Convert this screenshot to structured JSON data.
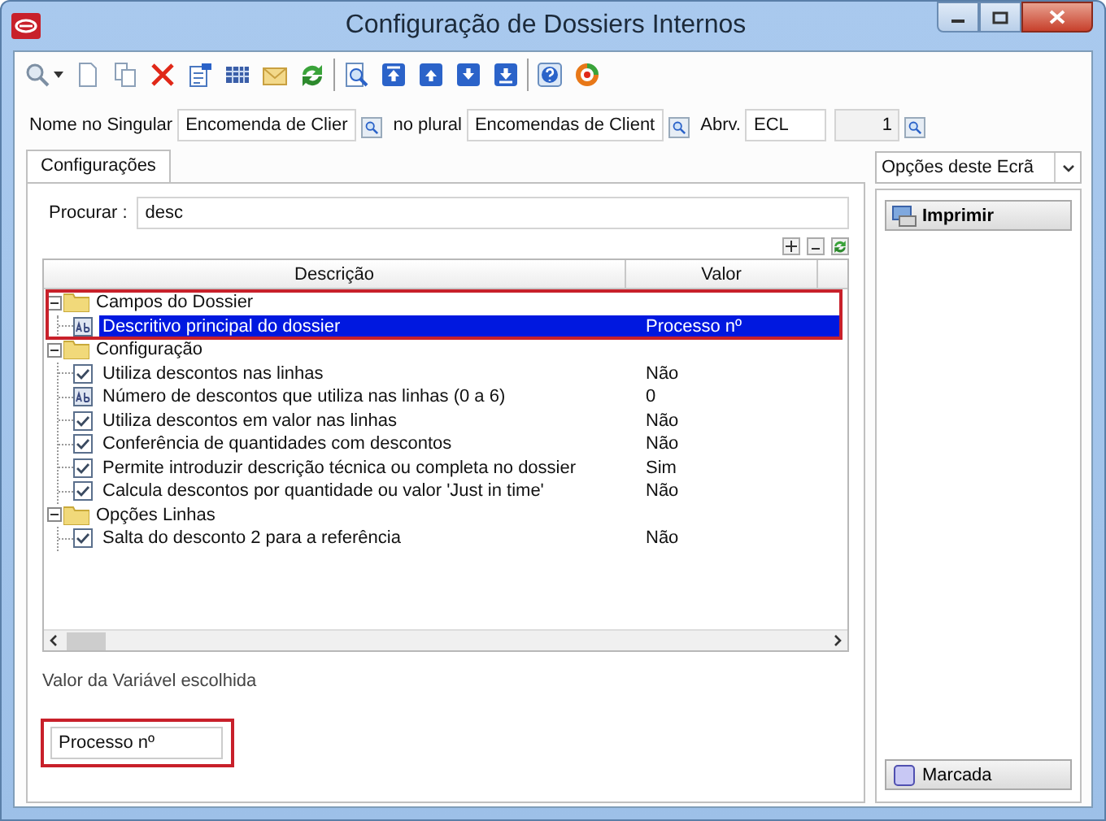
{
  "window": {
    "title": "Configuração de Dossiers Internos"
  },
  "header_fields": {
    "singular_label": "Nome no Singular",
    "singular_value": "Encomenda de Clier",
    "plural_label": "no plural",
    "plural_value": "Encomendas de Client",
    "abbr_label": "Abrv.",
    "abbr_value": "ECL",
    "number_value": "1"
  },
  "tabs": [
    {
      "label": "Configurações",
      "selected": true
    }
  ],
  "search": {
    "label": "Procurar :",
    "value": "desc"
  },
  "tree": {
    "columns": [
      "Descrição",
      "Valor"
    ],
    "groups": [
      {
        "label": "Campos do Dossier",
        "expanded": true,
        "highlighted": true,
        "children": [
          {
            "kind": "text",
            "label": "Descritivo principal do dossier",
            "value": "Processo nº",
            "selected": true
          }
        ]
      },
      {
        "label": "Configuração",
        "expanded": true,
        "highlighted": false,
        "children": [
          {
            "kind": "checkbox",
            "checked": true,
            "label": "Utiliza descontos nas linhas",
            "value": "Não",
            "selected": false
          },
          {
            "kind": "text",
            "label": "Número de descontos que utiliza nas linhas (0 a 6)",
            "value": "0",
            "selected": false
          },
          {
            "kind": "checkbox",
            "checked": true,
            "label": "Utiliza descontos em valor nas linhas",
            "value": "Não",
            "selected": false
          },
          {
            "kind": "checkbox",
            "checked": true,
            "label": "Conferência de quantidades com descontos",
            "value": "Não",
            "selected": false
          },
          {
            "kind": "checkbox",
            "checked": true,
            "label": "Permite introduzir descrição técnica ou completa no dossier",
            "value": "Sim",
            "selected": false
          },
          {
            "kind": "checkbox",
            "checked": true,
            "label": "Calcula descontos por quantidade ou valor 'Just in time'",
            "value": "Não",
            "selected": false
          }
        ]
      },
      {
        "label": "Opções Linhas",
        "expanded": true,
        "highlighted": false,
        "children": [
          {
            "kind": "checkbox",
            "checked": true,
            "label": "Salta do desconto 2 para a referência",
            "value": "Não",
            "selected": false
          }
        ]
      }
    ]
  },
  "selected_value": {
    "label": "Valor da Variável escolhida",
    "value": "Processo nº",
    "highlighted": true
  },
  "side_panel": {
    "dropdown": "Opções deste Ecrã",
    "buttons": [
      {
        "kind": "print",
        "label": "Imprimir"
      },
      {
        "kind": "mark",
        "label": "Marcada"
      }
    ]
  }
}
